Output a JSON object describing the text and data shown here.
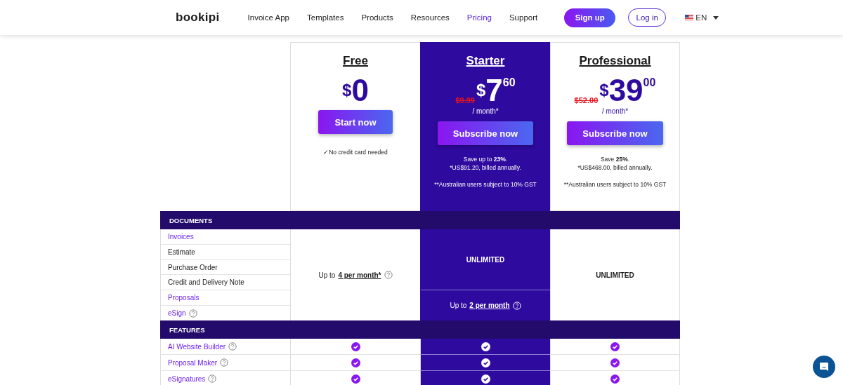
{
  "header": {
    "logo": "bookipi",
    "nav": [
      {
        "label": "Invoice App",
        "selected": false
      },
      {
        "label": "Templates",
        "selected": false
      },
      {
        "label": "Products",
        "selected": false
      },
      {
        "label": "Resources",
        "selected": false
      },
      {
        "label": "Pricing",
        "selected": true
      },
      {
        "label": "Support",
        "selected": false
      }
    ],
    "signup": "Sign up",
    "login": "Log in",
    "language": "EN"
  },
  "plans": [
    {
      "name": "Free",
      "highlighted": false,
      "currency": "$",
      "amount": "0",
      "button": "Start now",
      "notes": [
        {
          "text": "✓No credit card needed",
          "spaced": false
        }
      ]
    },
    {
      "name": "Starter",
      "highlighted": true,
      "old_price": "$9.99",
      "currency": "$",
      "amount": "7",
      "cents": "60",
      "period": "/ month*",
      "button": "Subscribe now",
      "notes": [
        {
          "text": "Save up to **23%**.",
          "spaced": false
        },
        {
          "text": "*US$91.20, billed annually.",
          "spaced": false
        },
        {
          "text": "**Australian users subject to 10% GST",
          "spaced": true
        }
      ]
    },
    {
      "name": "Professional",
      "highlighted": false,
      "old_price": "$52.00",
      "currency": "$",
      "amount": "39",
      "cents": "00",
      "period": "/ month*",
      "button": "Subscribe now",
      "notes": [
        {
          "text": "Save **25%**.",
          "spaced": false
        },
        {
          "text": "*US$468.00, billed annually.",
          "spaced": false
        },
        {
          "text": "**Australian users subject to 10% GST",
          "spaced": true
        }
      ]
    }
  ],
  "documents": {
    "title": "DOCUMENTS",
    "items": [
      {
        "label": "Invoices",
        "link": true,
        "help": false
      },
      {
        "label": "Estimate",
        "link": false,
        "help": false
      },
      {
        "label": "Purchase Order",
        "link": false,
        "help": false
      },
      {
        "label": "Credit and Delivery Note",
        "link": false,
        "help": false
      },
      {
        "label": "Proposals",
        "link": true,
        "help": false
      },
      {
        "label": "eSign",
        "link": true,
        "help": true
      }
    ],
    "plan_cells": [
      [
        {
          "kind": "limit",
          "prefix": "Up to",
          "link": "4 per month*",
          "help": true
        }
      ],
      [
        {
          "kind": "unlimited",
          "text": "UNLIMITED"
        },
        {
          "kind": "limit",
          "prefix": "Up to",
          "link": "2 per month",
          "help": true
        }
      ],
      [
        {
          "kind": "unlimited",
          "text": "UNLIMITED"
        }
      ]
    ]
  },
  "features": {
    "title": "FEATURES",
    "items": [
      {
        "label": "AI Website Builder",
        "link": true,
        "help": true,
        "included": [
          true,
          true,
          true
        ]
      },
      {
        "label": "Proposal Maker",
        "link": true,
        "help": true,
        "included": [
          true,
          true,
          true
        ]
      },
      {
        "label": "eSignatures",
        "link": true,
        "help": true,
        "included": [
          true,
          true,
          true
        ]
      }
    ]
  }
}
